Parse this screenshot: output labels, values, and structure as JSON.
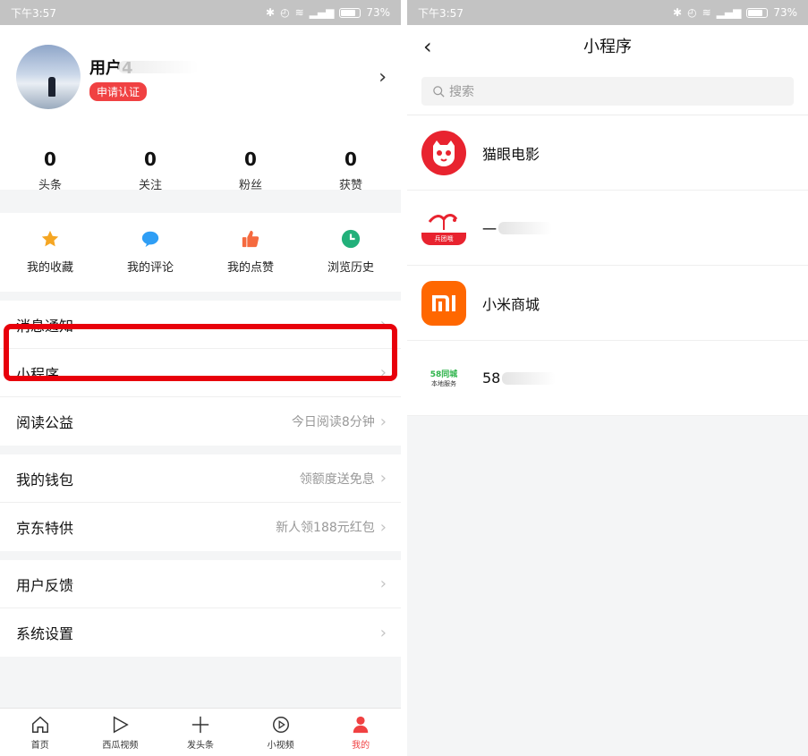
{
  "status_bar": {
    "time": "下午3:57",
    "battery": "73%"
  },
  "profile": {
    "username": "用户4",
    "cert_badge": "申请认证",
    "stats": [
      {
        "value": "0",
        "label": "头条"
      },
      {
        "value": "0",
        "label": "关注"
      },
      {
        "value": "0",
        "label": "粉丝"
      },
      {
        "value": "0",
        "label": "获赞"
      }
    ]
  },
  "quick_actions": [
    {
      "label": "我的收藏",
      "icon": "star-icon",
      "color": "#f5a623"
    },
    {
      "label": "我的评论",
      "icon": "comment-icon",
      "color": "#2f9ef5"
    },
    {
      "label": "我的点赞",
      "icon": "thumbs-up-icon",
      "color": "#f56a3f"
    },
    {
      "label": "浏览历史",
      "icon": "clock-icon",
      "color": "#22b07a"
    }
  ],
  "menu": {
    "group1": [
      {
        "label": "消息通知",
        "hint": ""
      },
      {
        "label": "小程序",
        "hint": ""
      },
      {
        "label": "阅读公益",
        "hint": "今日阅读8分钟"
      }
    ],
    "group2": [
      {
        "label": "我的钱包",
        "hint": "领额度送免息"
      },
      {
        "label": "京东特供",
        "hint": "新人领188元红包"
      }
    ],
    "group3": [
      {
        "label": "用户反馈",
        "hint": ""
      },
      {
        "label": "系统设置",
        "hint": ""
      }
    ]
  },
  "tabbar": [
    {
      "label": "首页",
      "icon": "home-icon",
      "active": false
    },
    {
      "label": "西瓜视频",
      "icon": "play-icon",
      "active": false
    },
    {
      "label": "发头条",
      "icon": "plus-icon",
      "active": false
    },
    {
      "label": "小视频",
      "icon": "small-video-icon",
      "active": false
    },
    {
      "label": "我的",
      "icon": "person-icon",
      "active": true
    }
  ],
  "mini_programs": {
    "title": "小程序",
    "search_placeholder": "搜索",
    "items": [
      {
        "name": "猫眼电影",
        "icon": "maoyan-cat-icon",
        "color": "#e8232f"
      },
      {
        "name": "一",
        "icon": "flamingo-icon",
        "color": "#e8232f",
        "icon_text": "兵团哦"
      },
      {
        "name": "小米商城",
        "icon": "mi-logo-icon",
        "color": "#ff6700"
      },
      {
        "name": "58",
        "icon": "58-logo-icon",
        "color": "#2db34a",
        "icon_text": "58同城",
        "icon_text2": "本地服务"
      }
    ]
  },
  "colors": {
    "brand_red": "#f04142",
    "highlight_red": "#e8000b"
  }
}
